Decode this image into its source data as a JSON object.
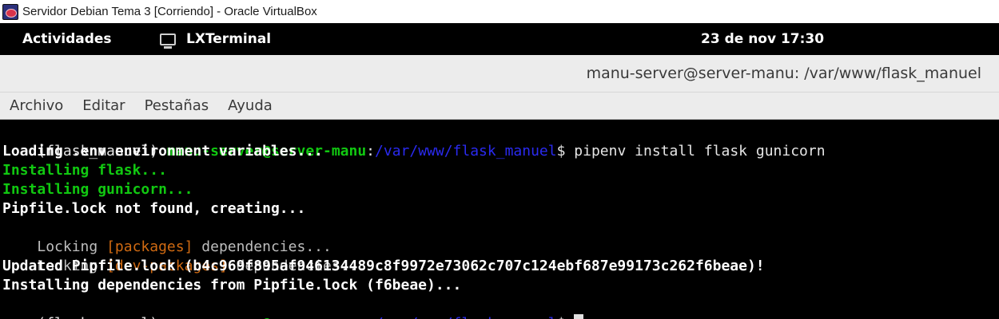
{
  "vbox": {
    "title": "Servidor Debian Tema 3 [Corriendo] - Oracle VirtualBox",
    "icon": "virtualbox-icon"
  },
  "topbar": {
    "activities": "Actividades",
    "app_name": "LXTerminal",
    "app_icon": "terminal-icon",
    "clock": "23 de nov  17:30"
  },
  "terminal_window": {
    "title": "manu-server@server-manu: /var/www/flask_manuel"
  },
  "menu": [
    "Archivo",
    "Editar",
    "Pestañas",
    "Ayuda"
  ],
  "terminal": {
    "prompt": {
      "env": "(flask_manuel) ",
      "user_host": "manu-server@server-manu",
      "colon": ":",
      "path": "/var/www/flask_manuel",
      "dollar": "$ "
    },
    "command": "pipenv install flask gunicorn",
    "out_loading_env": "Loading .env environment variables...",
    "out_installing_flask": "Installing flask...",
    "out_installing_gunicorn": "Installing gunicorn...",
    "out_pipfile_lock": "Pipfile.lock not found, creating...",
    "locking1": {
      "pre": "Locking ",
      "tag": "[packages]",
      "post": " dependencies..."
    },
    "locking2": {
      "pre": "Locking ",
      "tag": "[dev-packages]",
      "post": " dependencies..."
    },
    "out_updated": "Updated Pipfile.lock (b4c969f895af946134489c8f9972e73062c707c124ebf687e99173c262f6beae)!",
    "out_installing_deps": "Installing dependencies from Pipfile.lock (f6beae)..."
  }
}
